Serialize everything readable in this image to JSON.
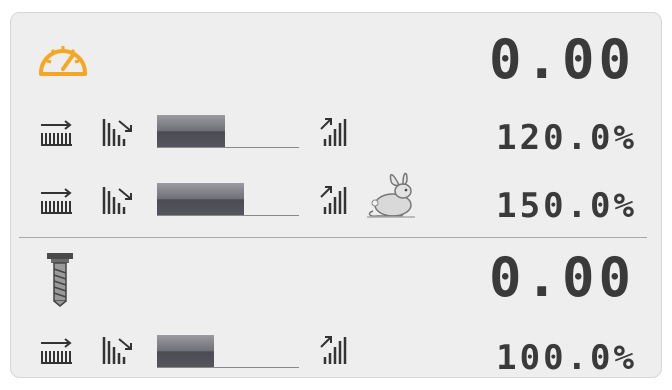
{
  "feed": {
    "value": "0.00",
    "icon": "speedometer-icon",
    "icon_color": "#f5a623",
    "feed_override": {
      "value": "120.0%",
      "fraction": 0.48
    },
    "rapid_override": {
      "value": "150.0%",
      "fraction": 0.61,
      "icon": "rabbit-icon"
    }
  },
  "spindle": {
    "value": "0.00",
    "icon": "spindle-icon",
    "spindle_override": {
      "value": "100.0%",
      "fraction": 0.4
    }
  },
  "colors": {
    "panel_bg": "#eeeeee",
    "text": "#3a3a3a",
    "bar_fill": "#5a5a62"
  }
}
